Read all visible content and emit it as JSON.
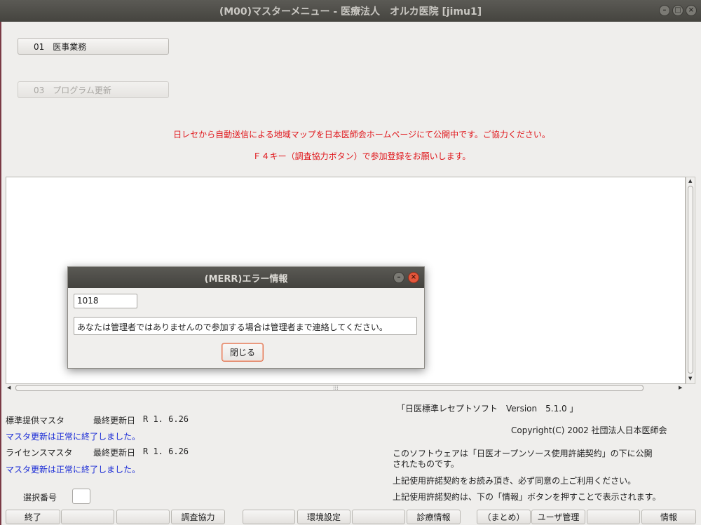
{
  "window": {
    "title": "(M00)マスターメニュー - 医療法人　オルカ医院 [jimu1]"
  },
  "menu": {
    "items": [
      {
        "label": "01　医事業務",
        "enabled": true
      },
      {
        "label": "03　プログラム更新",
        "enabled": false
      }
    ]
  },
  "notices": [
    "日レセから自動送信による地域マップを日本医師会ホームページにて公開中です。ご協力ください。",
    "Ｆ４キー（調査協力ボタン）で参加登録をお願いします。"
  ],
  "dialog": {
    "title": "(MERR)エラー情報",
    "code": "1018",
    "message": "あなたは管理者ではありませんので参加する場合は管理者まで連絡してください。",
    "close_label": "閉じる"
  },
  "masters": [
    {
      "name": "標準提供マスタ",
      "updated_label": "最終更新日",
      "date": "R 1. 6.26",
      "status": "マスタ更新は正常に終了しました。"
    },
    {
      "name": "ライセンスマスタ",
      "updated_label": "最終更新日",
      "date": "R 1. 6.26",
      "status": "マスタ更新は正常に終了しました。"
    }
  ],
  "software": {
    "name": "「日医標準レセプトソフト　Version　5.1.0 」",
    "copyright": "Copyright(C) 2002 社団法人日本医師会",
    "license1": "このソフトウェアは「日医オープンソース使用許諾契約」の下に公開",
    "license2": "されたものです。",
    "license3": "上記使用許諾契約をお読み頂き、必ず同意の上ご利用ください。",
    "license4": "上記使用許諾契約は、下の「情報」ボタンを押すことで表示されます。"
  },
  "selection": {
    "label": "選択番号",
    "value": ""
  },
  "function_keys": [
    "終了",
    "",
    "",
    "調査協力",
    "",
    "環境設定",
    "",
    "診療情報",
    "（まとめ）",
    "ユーザ管理",
    "",
    "情報"
  ],
  "colors": {
    "notice": "#e0161b",
    "status_blue": "#1a2bd6",
    "titlebar": "#4f4e49",
    "close_button": "#e4563b"
  }
}
